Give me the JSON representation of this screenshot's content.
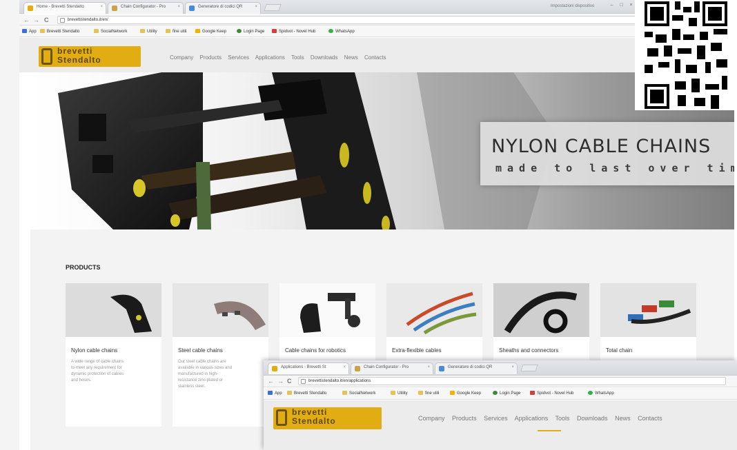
{
  "browser": {
    "tabs": [
      {
        "label": "Home - Brevetti Stendalto",
        "active": true
      },
      {
        "label": "Chain Configurator - Pro",
        "active": false
      },
      {
        "label": "Generatore di codici QR",
        "active": false
      }
    ],
    "tab_close": "×",
    "account": "Impostazioni dispositivo",
    "window_controls": [
      "–",
      "□",
      "×"
    ],
    "url": "brevettistendalto.it/en/",
    "nav": {
      "back": "←",
      "forward": "→",
      "reload": "C"
    },
    "bookmarks": [
      {
        "label": "App",
        "color": "#3d6fd8"
      },
      {
        "label": "Brevetti Stendalto",
        "color": "#e6c35a"
      },
      {
        "label": "SocialNetwork",
        "color": "#e6c35a"
      },
      {
        "label": "Utility",
        "color": "#e6c35a"
      },
      {
        "label": "fine utili",
        "color": "#e6c35a"
      },
      {
        "label": "Google Keep",
        "color": "#f2b400"
      },
      {
        "label": "Login Page",
        "color": "#3a8a3a"
      },
      {
        "label": "Spidvot - Novel Hub",
        "color": "#d04040"
      },
      {
        "label": "WhatsApp",
        "color": "#2fb344"
      }
    ]
  },
  "site": {
    "logo": {
      "line1": "brevetti",
      "line2": "Stendalto"
    },
    "menu": [
      "Company",
      "Products",
      "Services",
      "Applications",
      "Tools",
      "Downloads",
      "News",
      "Contacts"
    ],
    "hero": {
      "title": "NYLON CABLE CHAINS",
      "subtitle": "made to last over time"
    },
    "products_title": "PRODUCTS",
    "products": [
      {
        "name": "Nylon cable chains",
        "desc": "A wide range of cable chains to meet any requirement for dynamic protection of cables and hoses."
      },
      {
        "name": "Steel cable chains",
        "desc": "Our steel cable chains are available in various sizes and manufactured in high-resistance zinc-plated or stainless steel."
      },
      {
        "name": "Cable chains for robotics",
        "desc": ""
      },
      {
        "name": "Extra-flexible cables",
        "desc": ""
      },
      {
        "name": "Sheaths and connectors",
        "desc": ""
      },
      {
        "name": "Total chain",
        "desc": ""
      }
    ]
  },
  "overlay_browser": {
    "tabs": [
      {
        "label": "Applications - Brevetti St",
        "active": true
      },
      {
        "label": "Chain Configurator - Pro",
        "active": false
      },
      {
        "label": "Generatore di codici QR",
        "active": false
      }
    ],
    "url": "brevettistendalto.it/en/applications",
    "menu": [
      "Company",
      "Products",
      "Services",
      "Applications",
      "Tools",
      "Downloads",
      "News",
      "Contacts"
    ],
    "active_menu": "Applications"
  },
  "colors": {
    "brand_yellow": "#e2ad12",
    "brand_dark": "#5c4505",
    "hero_text": "#2d2d2d"
  },
  "icons": [
    "back-icon",
    "forward-icon",
    "reload-icon",
    "lock-icon",
    "qr-code-icon"
  ]
}
